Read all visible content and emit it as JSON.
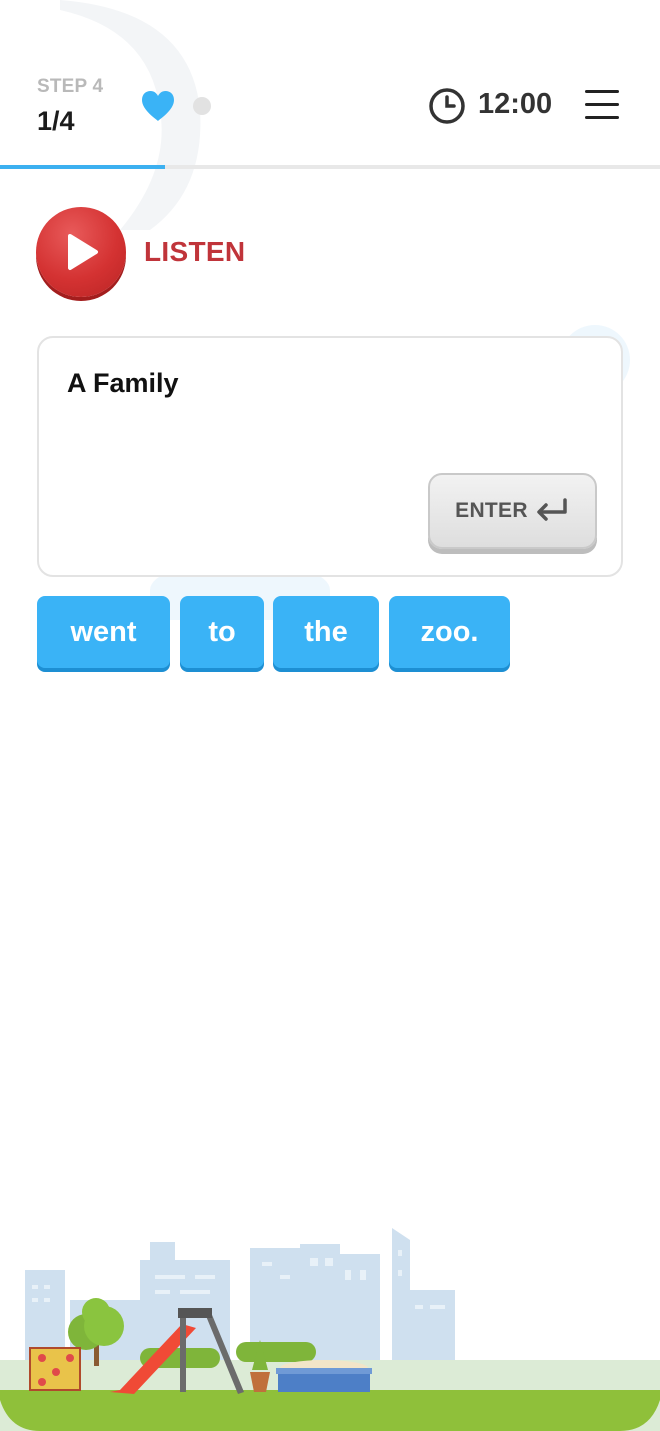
{
  "header": {
    "step_label": "STEP 4",
    "step_count": "1/4",
    "timer": "12:00",
    "progress_fraction": 0.25,
    "icons": [
      "heart-icon",
      "dot-icon",
      "clock-icon",
      "menu-icon"
    ]
  },
  "listen": {
    "label": "LISTEN",
    "icon": "play-icon"
  },
  "sentence": {
    "text": "A Family",
    "enter_label": "ENTER",
    "enter_icon": "return-arrow-icon"
  },
  "word_bank": [
    "went",
    "to",
    "the",
    "zoo."
  ],
  "colors": {
    "accent_blue": "#3ab3f6",
    "listen_red": "#c0343a",
    "grass_green": "#8fc03a"
  }
}
